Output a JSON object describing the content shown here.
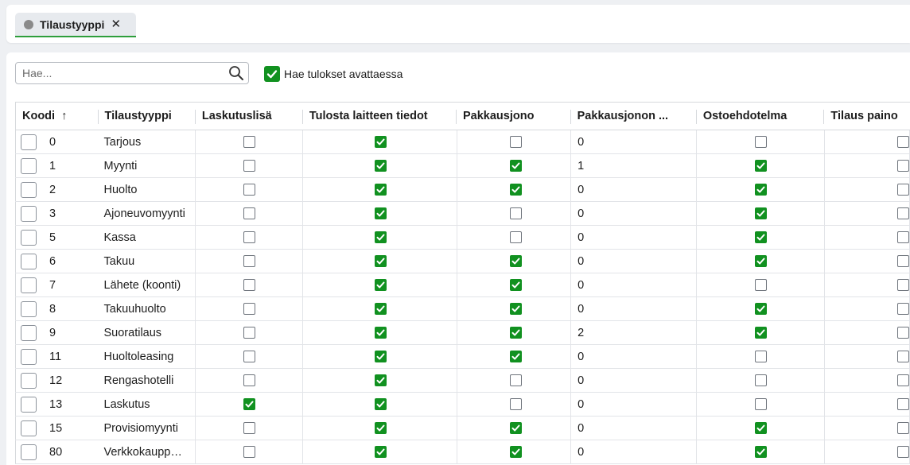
{
  "tab": {
    "label": "Tilaustyyppi",
    "close": "✕"
  },
  "search": {
    "placeholder": "Hae..."
  },
  "autoload": {
    "label": "Hae tulokset avattaessa",
    "checked": true
  },
  "columns": [
    "Koodi",
    "Tilaustyyppi",
    "Laskutuslisä",
    "Tulosta laitteen tiedot",
    "Pakkausjono",
    "Pakkausjonon ...",
    "Ostoehdotelma",
    "Tilaus paino"
  ],
  "sort_indicator": "↑",
  "rows": [
    {
      "code": "0",
      "type": "Tarjous",
      "laskutuslisa": false,
      "tulosta": true,
      "pakkausjono": false,
      "pakkausjonon": "0",
      "ostoehdotelma": false
    },
    {
      "code": "1",
      "type": "Myynti",
      "laskutuslisa": false,
      "tulosta": true,
      "pakkausjono": true,
      "pakkausjonon": "1",
      "ostoehdotelma": true
    },
    {
      "code": "2",
      "type": "Huolto",
      "laskutuslisa": false,
      "tulosta": true,
      "pakkausjono": true,
      "pakkausjonon": "0",
      "ostoehdotelma": true
    },
    {
      "code": "3",
      "type": "Ajoneuvomyynti",
      "laskutuslisa": false,
      "tulosta": true,
      "pakkausjono": false,
      "pakkausjonon": "0",
      "ostoehdotelma": true
    },
    {
      "code": "5",
      "type": "Kassa",
      "laskutuslisa": false,
      "tulosta": true,
      "pakkausjono": false,
      "pakkausjonon": "0",
      "ostoehdotelma": true
    },
    {
      "code": "6",
      "type": "Takuu",
      "laskutuslisa": false,
      "tulosta": true,
      "pakkausjono": true,
      "pakkausjonon": "0",
      "ostoehdotelma": true
    },
    {
      "code": "7",
      "type": "Lähete (koonti)",
      "laskutuslisa": false,
      "tulosta": true,
      "pakkausjono": true,
      "pakkausjonon": "0",
      "ostoehdotelma": false
    },
    {
      "code": "8",
      "type": "Takuuhuolto",
      "laskutuslisa": false,
      "tulosta": true,
      "pakkausjono": true,
      "pakkausjonon": "0",
      "ostoehdotelma": true
    },
    {
      "code": "9",
      "type": "Suoratilaus",
      "laskutuslisa": false,
      "tulosta": true,
      "pakkausjono": true,
      "pakkausjonon": "2",
      "ostoehdotelma": true
    },
    {
      "code": "11",
      "type": "Huoltoleasing",
      "laskutuslisa": false,
      "tulosta": true,
      "pakkausjono": true,
      "pakkausjonon": "0",
      "ostoehdotelma": false
    },
    {
      "code": "12",
      "type": "Rengashotelli",
      "laskutuslisa": false,
      "tulosta": true,
      "pakkausjono": false,
      "pakkausjonon": "0",
      "ostoehdotelma": false
    },
    {
      "code": "13",
      "type": "Laskutus",
      "laskutuslisa": true,
      "tulosta": true,
      "pakkausjono": false,
      "pakkausjonon": "0",
      "ostoehdotelma": false
    },
    {
      "code": "15",
      "type": "Provisiomyynti",
      "laskutuslisa": false,
      "tulosta": true,
      "pakkausjono": true,
      "pakkausjonon": "0",
      "ostoehdotelma": true
    },
    {
      "code": "80",
      "type": "Verkkokaupp…",
      "laskutuslisa": false,
      "tulosta": true,
      "pakkausjono": true,
      "pakkausjonon": "0",
      "ostoehdotelma": true
    }
  ],
  "colors": {
    "accent_green": "#119120",
    "tab_underline": "#2e9e3b",
    "background": "#eef0f3"
  },
  "icons": {
    "search": "search-icon",
    "checkmark": "check-icon",
    "close": "close-icon"
  }
}
